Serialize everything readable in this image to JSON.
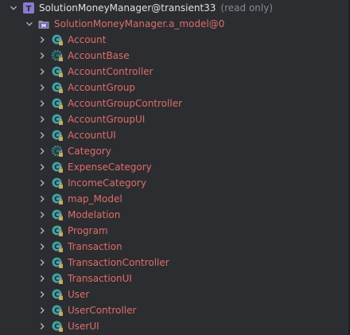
{
  "colors": {
    "background": "#2b2d30",
    "text": "#dfe1e5",
    "muted": "#868a91",
    "error_red": "#e06c6c",
    "root_badge": "#8a7bd1",
    "class_badge": "#3fa3a3",
    "lock_overlay": "#c9a86a",
    "run_overlay": "#5fb85f"
  },
  "root": {
    "badge_letter": "T",
    "label": "SolutionMoneyManager@transient33",
    "suffix": "(read only)"
  },
  "module": {
    "label": "SolutionMoneyManager.a_model@0",
    "badge_letter": "M"
  },
  "items": [
    {
      "label": "Account",
      "badge": "class-locked"
    },
    {
      "label": "AccountBase",
      "badge": "abstract-class-locked"
    },
    {
      "label": "AccountController",
      "badge": "class-locked"
    },
    {
      "label": "AccountGroup",
      "badge": "class-locked"
    },
    {
      "label": "AccountGroupController",
      "badge": "class-locked"
    },
    {
      "label": "AccountGroupUI",
      "badge": "class-locked"
    },
    {
      "label": "AccountUI",
      "badge": "class-locked"
    },
    {
      "label": "Category",
      "badge": "abstract-class-locked"
    },
    {
      "label": "ExpenseCategory",
      "badge": "class-locked"
    },
    {
      "label": "IncomeCategory",
      "badge": "class-locked"
    },
    {
      "label": "map_Model",
      "badge": "class-locked"
    },
    {
      "label": "Modelation",
      "badge": "class-locked"
    },
    {
      "label": "Program",
      "badge": "class-runnable-locked"
    },
    {
      "label": "Transaction",
      "badge": "class-locked"
    },
    {
      "label": "TransactionController",
      "badge": "class-locked"
    },
    {
      "label": "TransactionUI",
      "badge": "class-locked"
    },
    {
      "label": "User",
      "badge": "class-locked"
    },
    {
      "label": "UserController",
      "badge": "class-locked"
    },
    {
      "label": "UserUI",
      "badge": "class-locked"
    }
  ]
}
